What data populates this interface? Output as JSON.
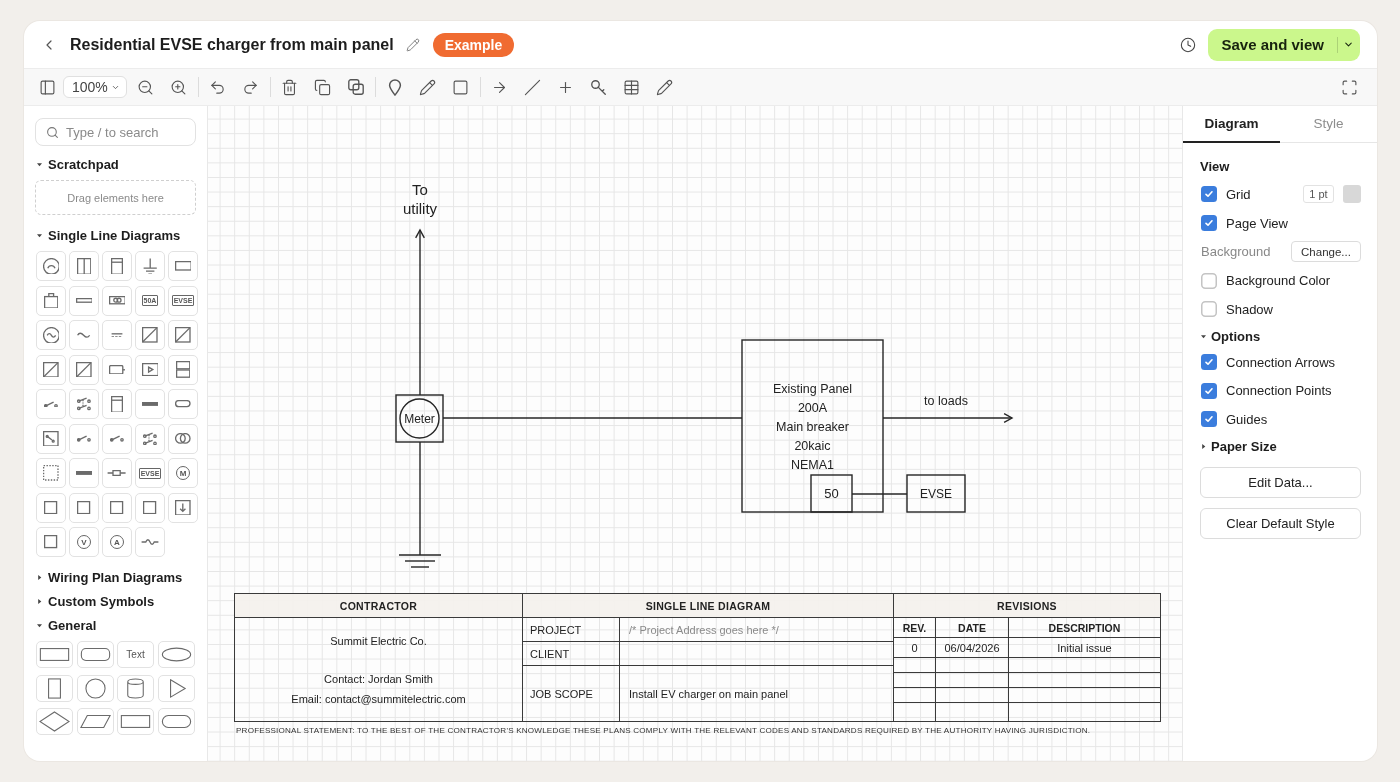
{
  "header": {
    "title": "Residential EVSE charger from main panel",
    "badge": "Example",
    "save_button": "Save and view"
  },
  "toolbar": {
    "zoom": "100%"
  },
  "sidebar": {
    "search": {
      "placeholder": "Type / to search"
    },
    "sections": [
      {
        "title": "Scratchpad",
        "expanded": true,
        "kind": "dropzone",
        "hint": "Drag elements here"
      },
      {
        "title": "Single Line Diagrams",
        "expanded": true,
        "kind": "symbols",
        "shapes": [
          {
            "kind": "gauge"
          },
          {
            "kind": "split"
          },
          {
            "kind": "cabinet"
          },
          {
            "kind": "ground"
          },
          {
            "kind": "rect"
          },
          {
            "kind": "case"
          },
          {
            "kind": "strip"
          },
          {
            "kind": "relay"
          },
          {
            "kind": "tag",
            "label": "50A"
          },
          {
            "kind": "tag",
            "label": "EVSE"
          },
          {
            "kind": "generator"
          },
          {
            "kind": "tilde"
          },
          {
            "kind": "dc"
          },
          {
            "kind": "diagonal"
          },
          {
            "kind": "diagonal"
          },
          {
            "kind": "diagonal"
          },
          {
            "kind": "diagonal"
          },
          {
            "kind": "battery"
          },
          {
            "kind": "player"
          },
          {
            "kind": "stack"
          },
          {
            "kind": "switch"
          },
          {
            "kind": "multiswitch"
          },
          {
            "kind": "cabinet"
          },
          {
            "kind": "busbar"
          },
          {
            "kind": "pill"
          },
          {
            "kind": "switchbox"
          },
          {
            "kind": "switch"
          },
          {
            "kind": "switch"
          },
          {
            "kind": "multiswitch"
          },
          {
            "kind": "rings"
          },
          {
            "kind": "dotted"
          },
          {
            "kind": "busbar"
          },
          {
            "kind": "fuse"
          },
          {
            "kind": "tag",
            "label": "EVSE"
          },
          {
            "kind": "lettered",
            "label": "M"
          },
          {
            "kind": "square"
          },
          {
            "kind": "square"
          },
          {
            "kind": "square"
          },
          {
            "kind": "square"
          },
          {
            "kind": "download"
          },
          {
            "kind": "square"
          },
          {
            "kind": "lettered",
            "label": "V"
          },
          {
            "kind": "lettered",
            "label": "A"
          },
          {
            "kind": "wave"
          }
        ]
      },
      {
        "title": "Wiring Plan Diagrams",
        "expanded": false
      },
      {
        "title": "Custom Symbols",
        "expanded": false
      },
      {
        "title": "General",
        "expanded": true,
        "kind": "shapes",
        "shapes": [
          {
            "kind": "rect"
          },
          {
            "kind": "rounded"
          },
          {
            "kind": "text",
            "label": "Text"
          },
          {
            "kind": "ellipse"
          },
          {
            "kind": "tall"
          },
          {
            "kind": "circle"
          },
          {
            "kind": "cylinder"
          },
          {
            "kind": "triangle"
          },
          {
            "kind": "diamond"
          },
          {
            "kind": "parallelogram"
          },
          {
            "kind": "rect"
          },
          {
            "kind": "pill"
          }
        ]
      }
    ]
  },
  "diagram": {
    "nodes": [
      {
        "kind": "label",
        "lines": [
          "To",
          "utility"
        ]
      },
      {
        "kind": "meter",
        "lines": [
          "Meter"
        ]
      },
      {
        "kind": "panel",
        "lines": [
          "Existing Panel",
          "200A",
          "Main breaker",
          "20kaic",
          "NEMA1"
        ]
      },
      {
        "kind": "breaker",
        "lines": [
          "50"
        ]
      },
      {
        "kind": "box",
        "lines": [
          "EVSE"
        ]
      },
      {
        "kind": "label",
        "lines": [
          "to loads"
        ]
      },
      {
        "kind": "ground"
      }
    ],
    "edges": [
      {
        "kind": "arrow"
      },
      {
        "kind": "line"
      },
      {
        "kind": "line"
      },
      {
        "kind": "arrow"
      },
      {
        "kind": "line"
      }
    ]
  },
  "title_block": {
    "contractor": {
      "heading": "CONTRACTOR",
      "lines": [
        "Summit Electric Co.",
        "Contact: Jordan Smith",
        "Email: contact@summitelectric.com"
      ]
    },
    "project": {
      "heading": "SINGLE LINE DIAGRAM",
      "rows": [
        {
          "label": "PROJECT",
          "value": "/* Project Address goes here */",
          "muted": true
        },
        {
          "label": "CLIENT"
        },
        {
          "label": "JOB SCOPE",
          "value": "Install EV charger on main panel",
          "muted": false
        }
      ]
    },
    "revisions": {
      "heading": "REVISIONS",
      "columns": [
        "REV.",
        "DATE",
        "DESCRIPTION"
      ],
      "rows": [
        [
          "0",
          "06/04/2026",
          "Initial issue"
        ]
      ]
    },
    "statement": "PROFESSIONAL STATEMENT: TO THE BEST OF THE CONTRACTOR'S KNOWLEDGE THESE PLANS COMPLY WITH THE RELEVANT CODES AND STANDARDS REQUIRED BY THE AUTHORITY HAVING JURISDICTION."
  },
  "properties": {
    "tabs": [
      {
        "label": "Diagram",
        "selected": true
      },
      {
        "label": "Style",
        "selected": false
      }
    ],
    "view": {
      "title": "View",
      "rows": [
        {
          "kind": "checkbox",
          "label": "Grid",
          "checked": true,
          "value": "1 pt"
        },
        {
          "kind": "checkbox",
          "label": "Page View",
          "checked": true
        },
        {
          "kind": "action",
          "label": "Background",
          "button": "Change..."
        },
        {
          "kind": "checkbox",
          "label": "Background Color",
          "checked": false
        },
        {
          "kind": "checkbox",
          "label": "Shadow",
          "checked": false
        }
      ]
    },
    "groups": [
      {
        "title": "Options",
        "expanded": true,
        "rows": [
          {
            "kind": "checkbox",
            "label": "Connection Arrows",
            "checked": true
          },
          {
            "kind": "checkbox",
            "label": "Connection Points",
            "checked": true
          },
          {
            "kind": "checkbox",
            "label": "Guides",
            "checked": true
          }
        ]
      },
      {
        "title": "Paper Size",
        "expanded": false
      }
    ],
    "buttons": [
      "Edit Data...",
      "Clear Default Style"
    ]
  }
}
